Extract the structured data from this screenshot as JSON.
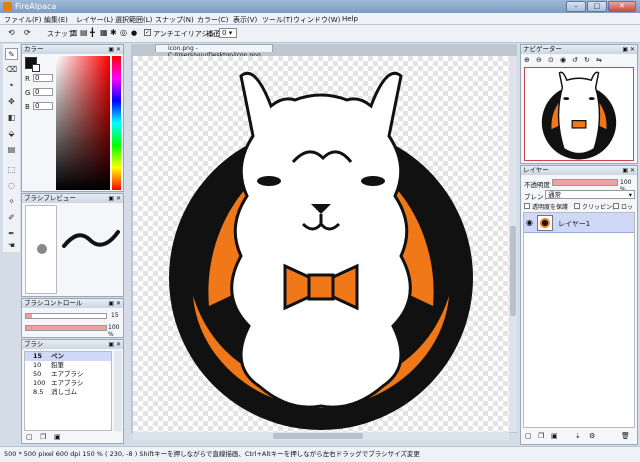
{
  "window": {
    "title": "FireAlpaca",
    "minimize": "–",
    "maximize": "□",
    "close": "✕"
  },
  "menus": [
    "ファイル(F)",
    "編集(E)",
    "レイヤー(L)",
    "選択範囲(L)",
    "スナップ(N)",
    "カラー(C)",
    "表示(V)",
    "ツール(T)",
    "ウィンドウ(W)",
    "Help"
  ],
  "toolbar": {
    "snap_label": "スナップ",
    "antialias_label": "アンチエイリアシング",
    "antialias_checked": true,
    "correction_label": "補正",
    "correction_value": "0"
  },
  "color_panel": {
    "title": "カラー",
    "r_label": "R",
    "r_value": "0",
    "g_label": "G",
    "g_value": "0",
    "b_label": "B",
    "b_value": "0",
    "current_color": "#111111"
  },
  "brush_preview": {
    "title": "ブラシプレビュー"
  },
  "brush_control": {
    "title": "ブラシコントロール",
    "size": "15",
    "opacity": "100 %"
  },
  "brush_list": {
    "title": "ブラシ",
    "items": [
      {
        "size": "15",
        "name": "ペン",
        "selected": true
      },
      {
        "size": "10",
        "name": "鉛筆",
        "selected": false
      },
      {
        "size": "50",
        "name": "エアブラシ",
        "selected": false
      },
      {
        "size": "100",
        "name": "エアブラシ",
        "selected": false
      },
      {
        "size": "8.5",
        "name": "消しゴム",
        "selected": false
      }
    ]
  },
  "document": {
    "tab_title": "icon.png - C:/Users/yuu/Desktop/icon.png"
  },
  "navigator": {
    "title": "ナビゲーター"
  },
  "layer_panel": {
    "title": "レイヤー",
    "opacity_label": "不透明度",
    "opacity_value": "100 %",
    "blend_label": "ブレンド",
    "blend_value": "通常",
    "protect_label": "透明度を保護",
    "clipping_label": "クリッピング",
    "lock_label": "ロック",
    "layers": [
      {
        "name": "レイヤー1",
        "selected": true
      }
    ]
  },
  "status": {
    "text": "500 * 500 pixel   600 dpi   150 %   ( 230, -8 )   Shiftキーを押しながらで直線描画、Ctrl+Altキーを押しながら左右ドラッグでブラシサイズ変更"
  },
  "colors": {
    "orange": "#f07818",
    "accent": "#7d9cc2",
    "selection": "#cfd8f6"
  }
}
